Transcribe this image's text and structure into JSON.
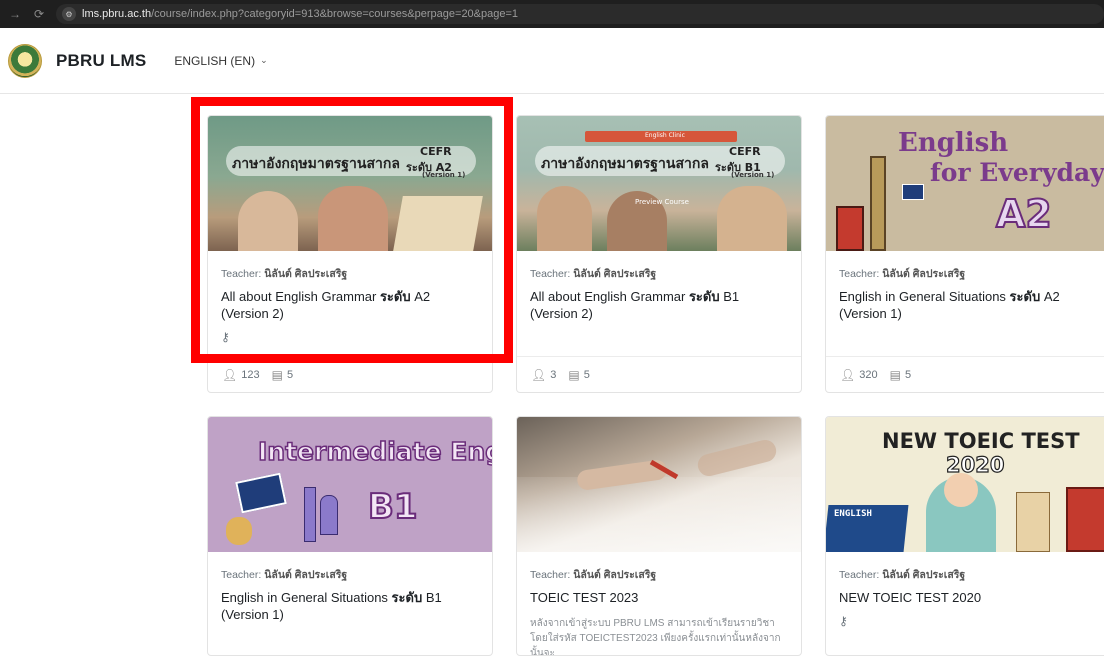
{
  "browser": {
    "url_host": "lms.pbru.ac.th",
    "url_path": "/course/index.php?categoryid=913&browse=courses&perpage=20&page=1"
  },
  "navbar": {
    "brand": "PBRU LMS",
    "language": "ENGLISH (EN)"
  },
  "courses": [
    {
      "teacher_label": "Teacher:",
      "teacher_name": "นิลันต์ ศิลประเสริฐ",
      "title_pre": "All about English Grammar ",
      "title_bold": "ระดับ",
      "title_post": " A2 (Version 2)",
      "image_text_main": "ภาษาอังกฤษมาตรฐานสากล",
      "image_text_level": "CEFR",
      "image_text_level2": "ระดับ A2",
      "image_text_version": "(Version 1)",
      "students": "123",
      "posts": "5"
    },
    {
      "teacher_label": "Teacher:",
      "teacher_name": "นิลันต์ ศิลประเสริฐ",
      "title_pre": "All about English Grammar ",
      "title_bold": "ระดับ",
      "title_post": " B1 (Version 2)",
      "image_banner": "English Clinic",
      "image_text_main": "ภาษาอังกฤษมาตรฐานสากล",
      "image_text_level": "CEFR",
      "image_text_level2": "ระดับ B1",
      "image_text_version": "(Version 1)",
      "image_overlay": "Preview Course",
      "students": "3",
      "posts": "5"
    },
    {
      "teacher_label": "Teacher:",
      "teacher_name": "นิลันต์ ศิลประเสริฐ",
      "title_pre": "English in General Situations ",
      "title_bold": "ระดับ",
      "title_post": " A2 (Version 1)",
      "image_line1": "English",
      "image_line2": "for Everyday Life",
      "image_line3": "A2",
      "students": "320",
      "posts": "5"
    },
    {
      "teacher_label": "Teacher:",
      "teacher_name": "นิลันต์ ศิลประเสริฐ",
      "title_pre": "English in General Situations ",
      "title_bold": "ระดับ",
      "title_post": " B1 (Version 1)",
      "image_line1": "Intermediate English",
      "image_line2": "B1"
    },
    {
      "teacher_label": "Teacher:",
      "teacher_name": "นิลันต์ ศิลประเสริฐ",
      "title_pre": "TOEIC TEST 2023",
      "title_bold": "",
      "title_post": "",
      "description": "หลังจากเข้าสู่ระบบ PBRU LMS สามารถเข้าเรียนรายวิชาโดยใส่รหัส TOEICTEST2023 เพียงครั้งแรกเท่านั้นหลังจากนั้นจะ"
    },
    {
      "teacher_label": "Teacher:",
      "teacher_name": "นิลันต์ ศิลประเสริฐ",
      "title_pre": "NEW TOEIC TEST 2020",
      "title_bold": "",
      "title_post": "",
      "image_line1": "NEW TOEIC TEST",
      "image_line2": "2020",
      "image_book": "ENGLISH"
    }
  ],
  "colors": {
    "highlight": "#ff0000",
    "card1_bg": "#5f8f7a",
    "card3_bg": "#c9bba0",
    "card4_bg": "#bfa2c6",
    "card6_bg": "#f1ecd6"
  }
}
